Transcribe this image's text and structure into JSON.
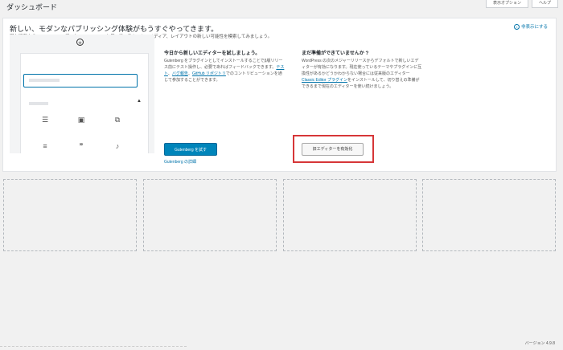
{
  "header": {
    "title": "ダッシュボード",
    "tabs": [
      "表示オプション",
      "ヘルプ"
    ]
  },
  "welcome_panel": {
    "heading": "新しい、モダンなパブリッシング体験がもうすぐやってきます。",
    "subheading": "現在開発中の WordPress エディター Gutenberg を使って、テキスト、メディア、レイアウトの新しい可能性を模索してみましょう。",
    "dismiss_label": "非表示にする",
    "try_column": {
      "title": "今日から新しいエディターを試しましょう。",
      "text_before": "Gutenberg をプラグインとしてインストールすることでβ版リリース前にテスト操作し、必要であればフィードバックできます。",
      "link1": "テスト",
      "sep": "、",
      "link2": "バグ報告",
      "sep2": "、",
      "link3": "GitHub リポジトリ",
      "text_after": "でのコントリビューションを通じて参加することができます。",
      "button_label": "Gutenberg を試す",
      "learn_link": "Gutenberg の詳細"
    },
    "classic_column": {
      "title": "まだ準備ができていませんか ?",
      "text_before": "WordPress の次のメジャーリリースからデフォルトで新しいエディターが有効になります。現在使っているテーマやプラグインに互換性があるかどうかわからない場合には従来版のエディター",
      "link": "Classic Editor プラグイン",
      "text_after": "をインストールして、切り替えの準備ができるまで現在のエディターを使い続けましょう。",
      "button_label": "旧エディターを有効化"
    }
  },
  "footer": {
    "version": "バージョン 4.9.8"
  },
  "colors": {
    "background": "#f1f1f1",
    "primary_button": "#0085ba",
    "link": "#0073aa",
    "highlight": "#d63638"
  }
}
